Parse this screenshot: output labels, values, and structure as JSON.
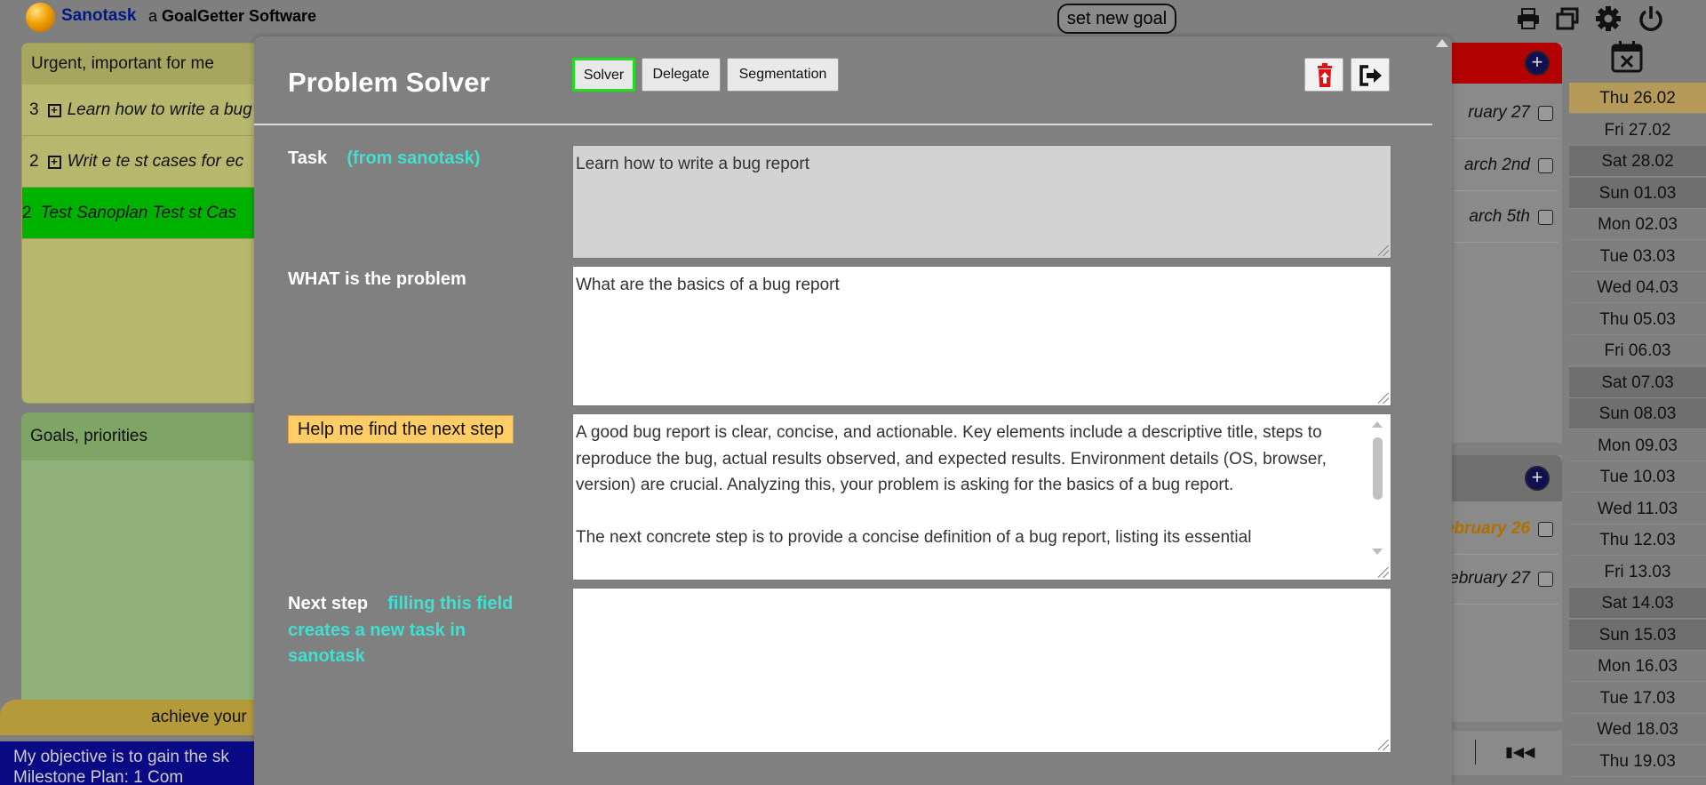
{
  "app": {
    "name": "Sanotask",
    "subtitle_a": "a",
    "subtitle_rest": "GoalGetter Software",
    "new_goal_label": "set new goal"
  },
  "icons": {
    "top": [
      "printer-icon",
      "windows-icon",
      "gear-icon",
      "power-icon"
    ],
    "calendar": "calendar-x-icon"
  },
  "background": {
    "urgent_title": "Urgent, important for me",
    "urgent_rows": [
      {
        "num": "3",
        "text": "Learn how to write a bug report"
      },
      {
        "num": "2",
        "text": "Writ e te st cases for ec"
      },
      {
        "num": "2",
        "text": "Test Sanoplan Test st Cas"
      }
    ],
    "goals_title": "Goals, priorities",
    "achieve_text": "achieve your",
    "objective_line1": "My objective is to gain the sk",
    "objective_line2": "Milestone   Plan:   1    Com",
    "right_dates_top": [
      "ruary 27",
      "arch 2nd",
      "arch 5th"
    ],
    "right_dates_bottom": [
      "ebruary 26",
      "ebruary 27"
    ],
    "colors": {
      "red_header": "#b30000",
      "urgent_panel": "#b7b76e",
      "goals_panel": "#91b27a",
      "green_row": "#00b200",
      "objective_bar": "#0a0a85"
    }
  },
  "calendar": {
    "days": [
      {
        "label": "Thu 26.02",
        "kind": "today"
      },
      {
        "label": "Fri 27.02",
        "kind": "weekday"
      },
      {
        "label": "Sat 28.02",
        "kind": "weekend"
      },
      {
        "label": "Sun 01.03",
        "kind": "weekend"
      },
      {
        "label": "Mon 02.03",
        "kind": "weekday"
      },
      {
        "label": "Tue 03.03",
        "kind": "weekday"
      },
      {
        "label": "Wed 04.03",
        "kind": "weekday"
      },
      {
        "label": "Thu 05.03",
        "kind": "weekday"
      },
      {
        "label": "Fri 06.03",
        "kind": "weekday"
      },
      {
        "label": "Sat 07.03",
        "kind": "weekend"
      },
      {
        "label": "Sun 08.03",
        "kind": "weekend"
      },
      {
        "label": "Mon 09.03",
        "kind": "weekday"
      },
      {
        "label": "Tue 10.03",
        "kind": "weekday"
      },
      {
        "label": "Wed 11.03",
        "kind": "weekday"
      },
      {
        "label": "Thu 12.03",
        "kind": "weekday"
      },
      {
        "label": "Fri 13.03",
        "kind": "weekday"
      },
      {
        "label": "Sat 14.03",
        "kind": "weekend"
      },
      {
        "label": "Sun 15.03",
        "kind": "weekend"
      },
      {
        "label": "Mon 16.03",
        "kind": "weekday"
      },
      {
        "label": "Tue 17.03",
        "kind": "weekday"
      },
      {
        "label": "Wed 18.03",
        "kind": "weekday"
      },
      {
        "label": "Thu 19.03",
        "kind": "weekday"
      }
    ]
  },
  "modal": {
    "title": "Problem Solver",
    "tabs": [
      {
        "label": "Solver",
        "active": true
      },
      {
        "label": "Delegate",
        "active": false
      },
      {
        "label": "Segmentation",
        "active": false
      }
    ],
    "actions": [
      "delete-icon",
      "exit-icon"
    ],
    "task_label": "Task",
    "task_note": "(from sanotask)",
    "task_value": "Learn how to write a bug report",
    "what_label": "WHAT is the problem",
    "what_value": "What are the basics of a bug report",
    "help_label": "Help me find the next step",
    "help_value": "A good bug report is clear, concise, and actionable. Key elements include a descriptive title, steps to reproduce the bug, actual results observed, and expected results. Environment details (OS, browser, version) are crucial. Analyzing this, your problem is asking for the basics of a bug report.\n\nThe next concrete step is to provide a concise definition of a bug report, listing its essential",
    "next_label": "Next step",
    "next_note": "filling this field creates a new task in sanotask",
    "next_value": "",
    "accent": "#40e0d0",
    "help_button_color": "#ffcc66",
    "active_tab_border": "#22dd22"
  }
}
